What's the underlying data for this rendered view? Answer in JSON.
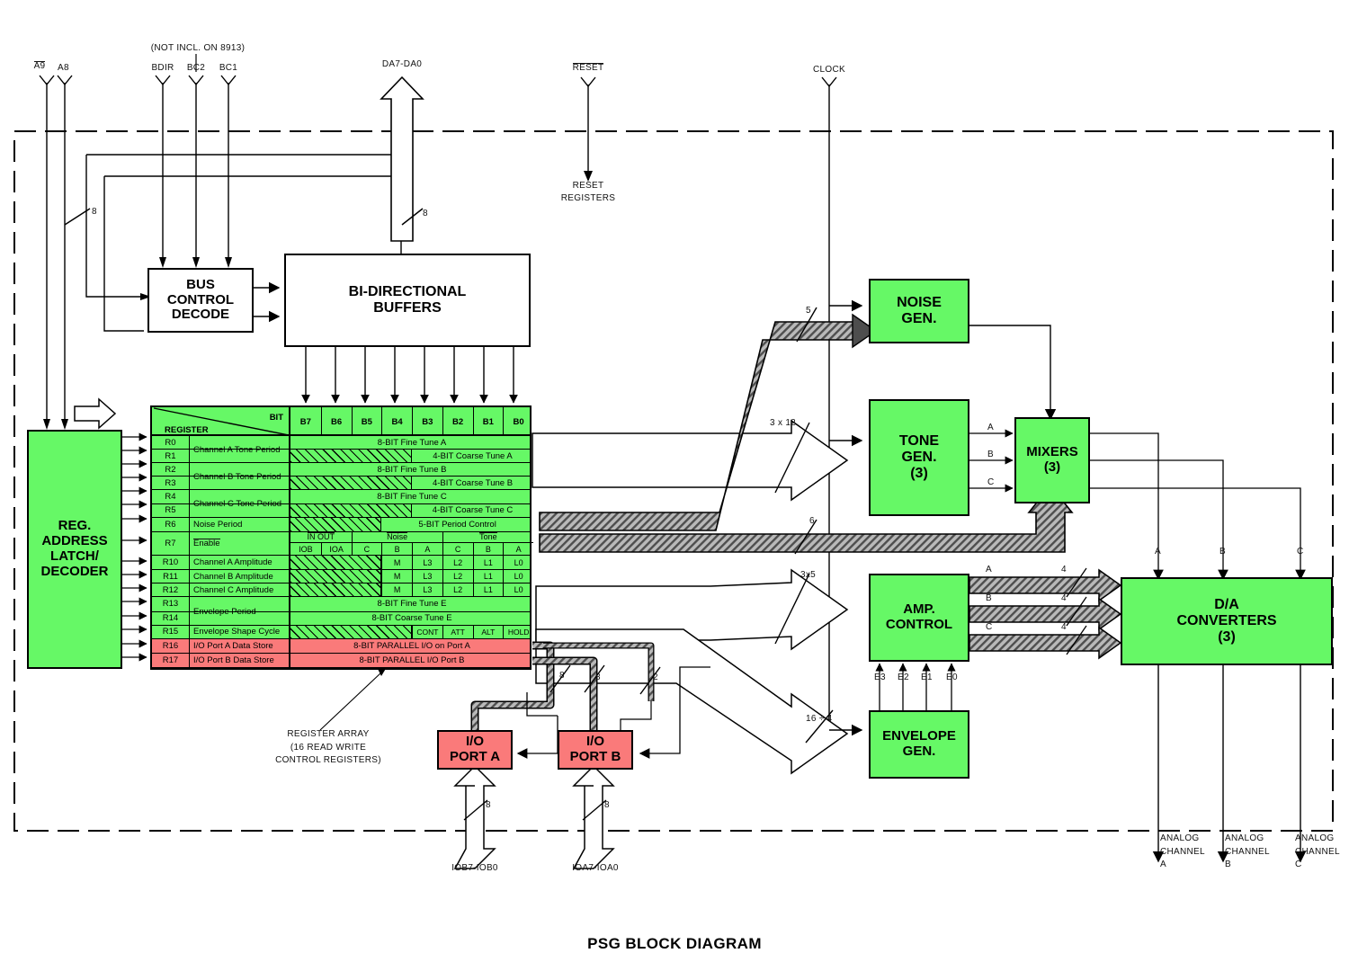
{
  "title": "PSG BLOCK DIAGRAM",
  "colors": {
    "green": "#66f866",
    "red": "#fa7a7a",
    "line": "#000000",
    "bus": "#8a8a8a"
  },
  "pins": {
    "a9": "A9",
    "a8": "A8",
    "not_incl": "(NOT INCL. ON 8913)",
    "bdir": "BDIR",
    "bc2": "BC2",
    "bc1": "BC1",
    "da": "DA7-DA0",
    "reset": "RESET",
    "reset_registers": "RESET\nREGISTERS",
    "clock": "CLOCK",
    "iob": "IOB7-IOB0",
    "ioa": "IOA7-IOA0",
    "analog_a": "ANALOG\nCHANNEL\nA",
    "analog_b": "ANALOG\nCHANNEL\nB",
    "analog_c": "ANALOG\nCHANNEL\nC"
  },
  "blocks": {
    "bus_control_decode": "BUS\nCONTROL\nDECODE",
    "bidirectional_buffers": "BI-DIRECTIONAL\nBUFFERS",
    "reg_address_latch": "REG.\nADDRESS\nLATCH/\nDECODER",
    "noise_gen": "NOISE\nGEN.",
    "tone_gen": "TONE\nGEN.\n(3)",
    "mixers": "MIXERS\n(3)",
    "amp_control": "AMP.\nCONTROL",
    "envelope_gen": "ENVELOPE\nGEN.",
    "da_converters": "D/A\nCONVERTERS\n(3)",
    "io_port_a": "I/O\nPORT A",
    "io_port_b": "I/O\nPORT B"
  },
  "annotations": {
    "register_array": "REGISTER ARRAY\n(16 READ WRITE\nCONTROL REGISTERS)"
  },
  "bus_widths": {
    "addr": "8",
    "data_top": "8",
    "noise_period": "5",
    "tone_period": "3 x 12",
    "mixer_ctrl": "6",
    "amp_ctrl": "3x5",
    "env_period": "16 ÷ 4",
    "dac_a": "4",
    "dac_b": "4",
    "dac_c": "4",
    "port_a_store": "8",
    "port_a_line": "8",
    "port_ctrl": "2",
    "iob_bus": "8",
    "ioa_bus": "8"
  },
  "mixer_inputs": {
    "a": "A",
    "b": "B",
    "c": "C"
  },
  "mixer_outputs": {
    "a": "A",
    "b": "B",
    "c": "C"
  },
  "amp_inputs": {
    "a": "A",
    "b": "B",
    "c": "C"
  },
  "envelope_bits": {
    "e3": "E3",
    "e2": "E2",
    "e1": "E1",
    "e0": "E0"
  },
  "register_table": {
    "corner_bit": "BIT",
    "corner_register": "REGISTER",
    "bit_headers": [
      "B7",
      "B6",
      "B5",
      "B4",
      "B3",
      "B2",
      "B1",
      "B0"
    ],
    "rows": [
      {
        "reg": "R0",
        "name": "Channel A Tone Period",
        "name_span": 2,
        "data": "8-BIT Fine Tune A",
        "style": "full"
      },
      {
        "reg": "R1",
        "name": "",
        "data": "4-BIT Coarse Tune A",
        "style": "hatch4"
      },
      {
        "reg": "R2",
        "name": "Channel B Tone Period",
        "name_span": 2,
        "data": "8-BIT Fine Tune B",
        "style": "full"
      },
      {
        "reg": "R3",
        "name": "",
        "data": "4-BIT Coarse Tune B",
        "style": "hatch4"
      },
      {
        "reg": "R4",
        "name": "Channel C Tone Period",
        "name_span": 2,
        "data": "8-BIT Fine Tune C",
        "style": "full"
      },
      {
        "reg": "R5",
        "name": "",
        "data": "4-BIT Coarse Tune C",
        "style": "hatch4"
      },
      {
        "reg": "R6",
        "name": "Noise Period",
        "data": "5-BIT Period Control",
        "style": "hatch3"
      },
      {
        "reg": "R7",
        "name": "Enable",
        "name_overline": true,
        "style": "enable",
        "groups": [
          {
            "label": "IN OUT",
            "overline": true,
            "cells": [
              "IOB",
              "IOA"
            ]
          },
          {
            "label": "Noise",
            "overline": true,
            "cells": [
              "C",
              "B",
              "A"
            ]
          },
          {
            "label": "Tone",
            "overline": true,
            "cells": [
              "C",
              "B",
              "A"
            ]
          }
        ]
      },
      {
        "reg": "R10",
        "name": "Channel A Amplitude",
        "style": "amp",
        "cells": [
          "M",
          "L3",
          "L2",
          "L1",
          "L0"
        ]
      },
      {
        "reg": "R11",
        "name": "Channel B Amplitude",
        "style": "amp",
        "cells": [
          "M",
          "L3",
          "L2",
          "L1",
          "L0"
        ]
      },
      {
        "reg": "R12",
        "name": "Channel C Amplitude",
        "style": "amp",
        "cells": [
          "M",
          "L3",
          "L2",
          "L1",
          "L0"
        ]
      },
      {
        "reg": "R13",
        "name": "Envelope Period",
        "name_span": 2,
        "data": "8-BIT Fine Tune E",
        "style": "full"
      },
      {
        "reg": "R14",
        "name": "",
        "data": "8-BIT Coarse Tune E",
        "style": "full"
      },
      {
        "reg": "R15",
        "name": "Envelope Shape Cycle",
        "style": "shape",
        "cells": [
          "CONT",
          "ATT",
          "ALT",
          "HOLD"
        ]
      },
      {
        "reg": "R16",
        "name": "I/O Port A Data Store",
        "data": "8-BIT PARALLEL I/O on Port A",
        "style": "red"
      },
      {
        "reg": "R17",
        "name": "I/O Port B Data Store",
        "data": "8-BIT PARALLEL I/O Port B",
        "style": "red"
      }
    ]
  }
}
